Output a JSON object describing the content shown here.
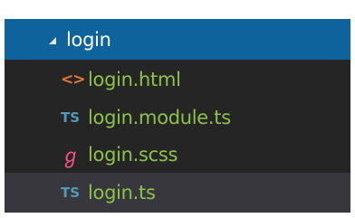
{
  "explorer": {
    "folder": {
      "label": "login",
      "expanded": true
    },
    "files": [
      {
        "label": "login.html",
        "icon": "html-icon",
        "icon_glyph": "<>",
        "icon_color": "#e37933"
      },
      {
        "label": "login.module.ts",
        "icon": "typescript-icon",
        "icon_glyph": "TS",
        "icon_color": "#519aba"
      },
      {
        "label": "login.scss",
        "icon": "sass-icon",
        "icon_glyph": "ℊ",
        "icon_color": "#f55385"
      },
      {
        "label": "login.ts",
        "icon": "typescript-icon",
        "icon_glyph": "TS",
        "icon_color": "#519aba"
      }
    ],
    "colors": {
      "panel_bg": "#252526",
      "folder_row_bg": "#0e639c",
      "file_label": "#8dc149",
      "selected_row_bg": "#37373d"
    }
  }
}
